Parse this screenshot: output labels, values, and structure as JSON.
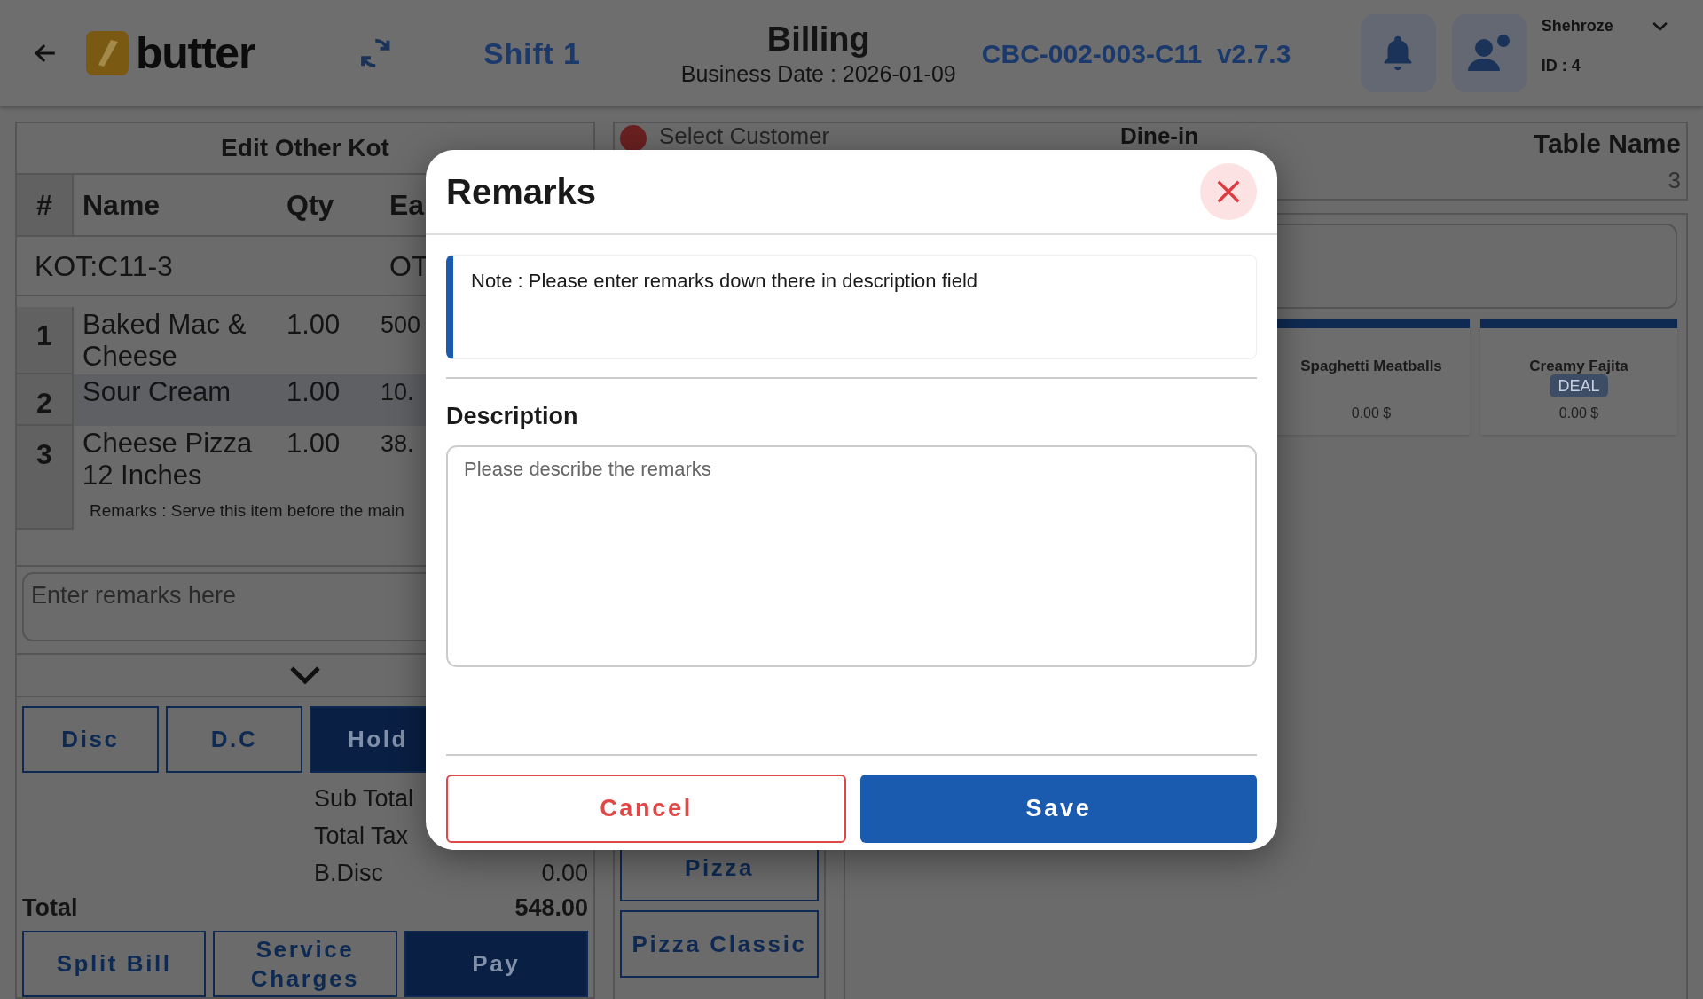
{
  "header": {
    "logo": "butter",
    "shift": "Shift 1",
    "title": "Billing",
    "business_date": "Business Date : 2026-01-09",
    "terminal": "CBC-002-003-C11  v2.7.3",
    "user_name": "Shehroze",
    "user_id": "ID : 4"
  },
  "order_panel": {
    "title": "Edit Other Kot",
    "columns": [
      "#",
      "Name",
      "Qty",
      "Ea"
    ],
    "kot": {
      "label": "KOT:C11-3",
      "tag": "OT"
    },
    "rows": [
      {
        "index": "1",
        "name": "Baked Mac & Cheese",
        "qty": "1.00",
        "each": "500",
        "selected": false
      },
      {
        "index": "2",
        "name": "Sour Cream",
        "qty": "1.00",
        "each": "10.",
        "selected": true
      },
      {
        "index": "3",
        "name": "Cheese Pizza 12 Inches",
        "qty": "1.00",
        "each": "38.",
        "selected": false,
        "remarks": "Remarks : Serve this item before the main"
      }
    ],
    "remarks_placeholder": "Enter remarks here",
    "actions": [
      {
        "label": "Disc",
        "filled": false
      },
      {
        "label": "D.C",
        "filled": false
      },
      {
        "label": "Hold",
        "filled": true
      }
    ],
    "totals": [
      {
        "label": "Sub Total"
      },
      {
        "label": "Total Tax"
      },
      {
        "label": "B.Disc",
        "value": "0.00"
      }
    ],
    "total": {
      "label": "Total",
      "value": "548.00"
    },
    "bottom_actions": [
      {
        "label": "Split Bill",
        "filled": false
      },
      {
        "label": "Service Charges",
        "filled": false
      },
      {
        "label": "Pay",
        "filled": true
      }
    ]
  },
  "categories": [
    "Pizza",
    "Pizza Classic"
  ],
  "customer_bar": {
    "customer": "Select Customer",
    "order_type": "Dine-in",
    "table_label": "Table Name",
    "table_value": "3"
  },
  "items": [
    {
      "name": "Spaghetti Meatballs",
      "price": "0.00 $"
    },
    {
      "name": "Creamy Fajita",
      "price": "0.00 $",
      "badge": "DEAL"
    }
  ],
  "dialog": {
    "title": "Remarks",
    "note": "Note : Please enter remarks down there in description field",
    "field_label": "Description",
    "placeholder": "Please describe the remarks",
    "buttons": [
      {
        "label": "Cancel",
        "kind": "secondary"
      },
      {
        "label": "Save",
        "kind": "primary"
      }
    ]
  }
}
